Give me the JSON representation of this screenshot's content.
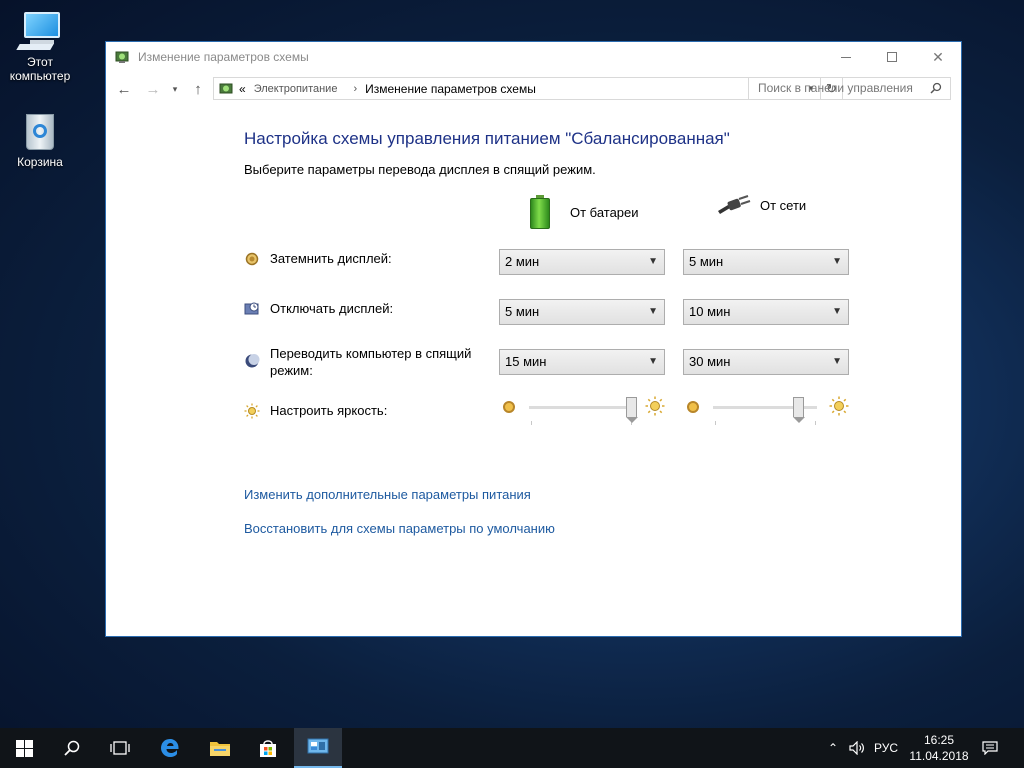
{
  "desktop": {
    "icons": [
      {
        "label_line1": "Этот",
        "label_line2": "компьютер"
      },
      {
        "label": "Корзина"
      }
    ]
  },
  "window": {
    "title": "Изменение параметров схемы",
    "breadcrumb": {
      "prefix": "«",
      "items": [
        "Электропитание",
        "Изменение параметров схемы"
      ]
    },
    "search": {
      "placeholder": "Поиск в панели управления"
    }
  },
  "content": {
    "heading": "Настройка схемы управления питанием \"Сбалансированная\"",
    "subheading": "Выберите параметры перевода дисплея в спящий режим.",
    "columns": {
      "battery": "От батареи",
      "ac": "От сети"
    },
    "rows": {
      "dim": {
        "label": "Затемнить дисплей:",
        "battery": "2 мин",
        "ac": "5 мин"
      },
      "off": {
        "label": "Отключать дисплей:",
        "battery": "5 мин",
        "ac": "10 мин"
      },
      "sleep": {
        "label": "Переводить компьютер в спящий режим:",
        "battery": "15 мин",
        "ac": "30 мин"
      },
      "brightness": {
        "label": "Настроить яркость:",
        "battery_fraction": 0.98,
        "ac_fraction": 0.82
      }
    },
    "links": {
      "advanced": "Изменить дополнительные параметры питания",
      "restore": "Восстановить для схемы параметры по умолчанию"
    }
  },
  "taskbar": {
    "language": "РУС",
    "time": "16:25",
    "date": "11.04.2018"
  },
  "colors": {
    "heading": "#1e3287",
    "link": "#1e5aa0",
    "window_border": "#2b6cb0",
    "taskbar": "#101418"
  }
}
